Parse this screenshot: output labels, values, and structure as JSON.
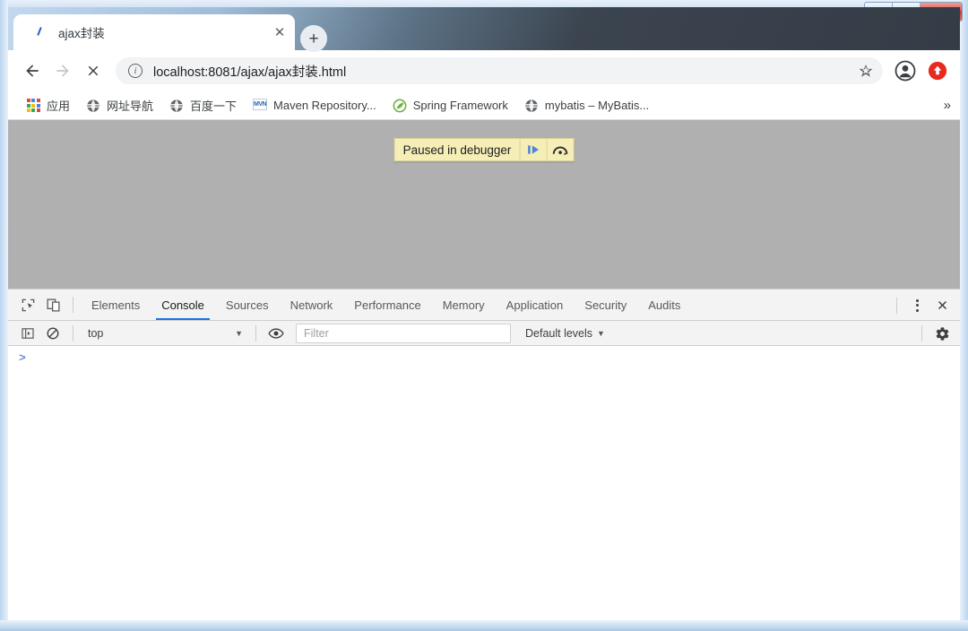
{
  "window": {
    "controls": {
      "minimize": "minimize-button",
      "maximize": "restore-button",
      "close": "✕"
    }
  },
  "tabstrip": {
    "tabs": [
      {
        "title": "ajax封装",
        "favicon": "page-favicon",
        "close_label": "✕"
      }
    ],
    "new_tab_label": "+"
  },
  "toolbar": {
    "back_label": "←",
    "forward_label": "→",
    "stop_label": "✕",
    "site_info_label": "i",
    "url_prefix": "localhost:8081",
    "url_path": "/ajax/ajax封装.html",
    "url_full": "localhost:8081/ajax/ajax封装.html",
    "bookmark_label": "☆",
    "profile_label": "profile-avatar",
    "menu_label": "browser-update-menu"
  },
  "bookmarks": {
    "items": [
      {
        "label": "应用",
        "icon": "apps-grid-icon"
      },
      {
        "label": "网址导航",
        "icon": "globe-icon"
      },
      {
        "label": "百度一下",
        "icon": "globe-icon"
      },
      {
        "label": "Maven Repository...",
        "icon": "mvn-icon",
        "icon_text": "MVN"
      },
      {
        "label": "Spring Framework",
        "icon": "spring-leaf-icon"
      },
      {
        "label": "mybatis – MyBatis...",
        "icon": "globe-icon"
      }
    ],
    "overflow_label": "»"
  },
  "page": {
    "debugger_banner": {
      "text": "Paused in debugger",
      "resume_label": "resume-script-execution",
      "step_over_label": "step-over-next-function-call"
    }
  },
  "devtools": {
    "inspect_label": "inspect-element",
    "device_toolbar_label": "toggle-device-toolbar",
    "tabs": [
      {
        "label": "Elements",
        "active": false
      },
      {
        "label": "Console",
        "active": true
      },
      {
        "label": "Sources",
        "active": false
      },
      {
        "label": "Network",
        "active": false
      },
      {
        "label": "Performance",
        "active": false
      },
      {
        "label": "Memory",
        "active": false
      },
      {
        "label": "Application",
        "active": false
      },
      {
        "label": "Security",
        "active": false
      },
      {
        "label": "Audits",
        "active": false
      }
    ],
    "more_label": "more-tools",
    "close_label": "✕",
    "console": {
      "sidebar_toggle_label": "show-console-sidebar",
      "clear_label": "clear-console",
      "context": "top",
      "context_caret": "▼",
      "live_expression_label": "create-live-expression",
      "filter_placeholder": "Filter",
      "filter_value": "",
      "levels_label": "Default levels",
      "levels_caret": "▼",
      "settings_label": "console-settings",
      "prompt_caret": ">",
      "prompt_value": "",
      "messages": []
    }
  },
  "colors": {
    "accent": "#1a73e8",
    "banner_bg": "#f5eeb6",
    "page_bg": "#b0b0b0",
    "frame": "#c3d9ef",
    "close_btn": "#c33b2e"
  }
}
